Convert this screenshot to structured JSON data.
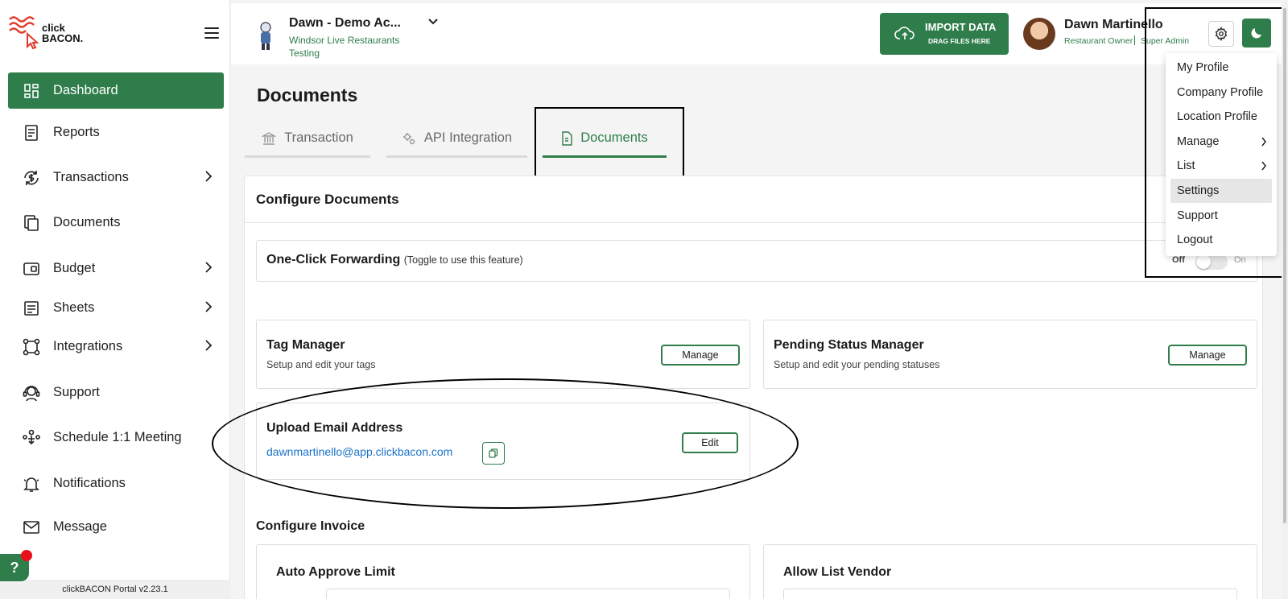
{
  "sidebar": {
    "logo": {
      "line1": "click",
      "line2": "BACON."
    },
    "items": [
      {
        "label": "Dashboard",
        "icon": "dashboard-grid-icon"
      },
      {
        "label": "Reports",
        "icon": "report-doc-icon"
      },
      {
        "label": "Transactions",
        "icon": "dollar-sync-icon"
      },
      {
        "label": "Documents",
        "icon": "documents-icon"
      },
      {
        "label": "Budget",
        "icon": "wallet-icon"
      },
      {
        "label": "Sheets",
        "icon": "sheet-icon"
      },
      {
        "label": "Integrations",
        "icon": "integrations-icon"
      },
      {
        "label": "Support",
        "icon": "headset-icon"
      },
      {
        "label": "Schedule 1:1 Meeting",
        "icon": "meeting-icon"
      },
      {
        "label": "Notifications",
        "icon": "bell-icon"
      },
      {
        "label": "Message",
        "icon": "mail-icon"
      }
    ],
    "help_label": "?",
    "version": "clickBACON Portal v2.23.1"
  },
  "header": {
    "account_name": "Dawn - Demo Ac...",
    "account_sub": "Windsor Live Restaurants Testing",
    "import_title": "IMPORT DATA",
    "import_sub": "DRAG FILES HERE",
    "user_name": "Dawn Martinello",
    "user_role": "Restaurant Owner",
    "user_role2": "Super Admin"
  },
  "page": {
    "title": "Documents",
    "tabs": [
      {
        "label": "Transaction"
      },
      {
        "label": "API Integration"
      },
      {
        "label": "Documents"
      }
    ],
    "configure_title": "Configure Documents",
    "one_click": {
      "title": "One-Click Forwarding",
      "hint": "(Toggle to use this feature)",
      "off": "Off",
      "on": "On",
      "enabled": false
    },
    "tag_manager": {
      "title": "Tag Manager",
      "sub": "Setup and edit your tags",
      "button": "Manage"
    },
    "pending_status": {
      "title": "Pending Status Manager",
      "sub": "Setup and edit your pending statuses",
      "button": "Manage"
    },
    "upload_email": {
      "title": "Upload Email Address",
      "email": "dawnmartinello@app.clickbacon.com",
      "button": "Edit"
    },
    "invoice_title": "Configure Invoice",
    "auto_approve": {
      "title": "Auto Approve Limit"
    },
    "allow_list": {
      "title": "Allow List Vendor"
    }
  },
  "profile_menu": {
    "items": [
      {
        "label": "My Profile"
      },
      {
        "label": "Company Profile"
      },
      {
        "label": "Location Profile"
      },
      {
        "label": "Manage"
      },
      {
        "label": "List"
      },
      {
        "label": "Settings"
      },
      {
        "label": "Support"
      },
      {
        "label": "Logout"
      }
    ]
  },
  "colors": {
    "brand_green": "#2f7d4b",
    "link_blue": "#1a73c9",
    "alert_red": "#e8101b"
  }
}
